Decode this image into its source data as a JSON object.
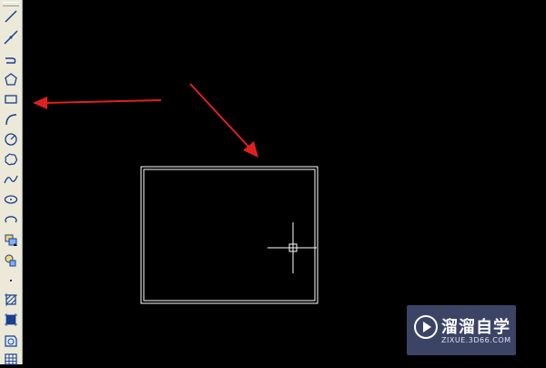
{
  "toolbar": {
    "tools": [
      {
        "icon": "line-icon"
      },
      {
        "icon": "construction-line-icon"
      },
      {
        "icon": "polyline-icon"
      },
      {
        "icon": "polygon-icon"
      },
      {
        "icon": "rectangle-icon"
      },
      {
        "icon": "arc-icon"
      },
      {
        "icon": "circle-icon"
      },
      {
        "icon": "revision-cloud-icon"
      },
      {
        "icon": "spline-icon"
      },
      {
        "icon": "ellipse-icon"
      },
      {
        "icon": "ellipse-arc-icon"
      },
      {
        "icon": "insert-block-icon"
      },
      {
        "icon": "make-block-icon"
      },
      {
        "icon": "point-icon"
      },
      {
        "icon": "hatch-icon"
      },
      {
        "icon": "gradient-icon"
      },
      {
        "icon": "region-icon"
      },
      {
        "icon": "table-icon"
      }
    ]
  },
  "colors": {
    "canvas": "#000000",
    "toolbar": "#ece9d8",
    "annotation_arrow": "#e02020",
    "drawing": "#ffffff"
  },
  "watermark": {
    "title": "溜溜自学",
    "url": "ZIXUE.3D66.COM"
  }
}
